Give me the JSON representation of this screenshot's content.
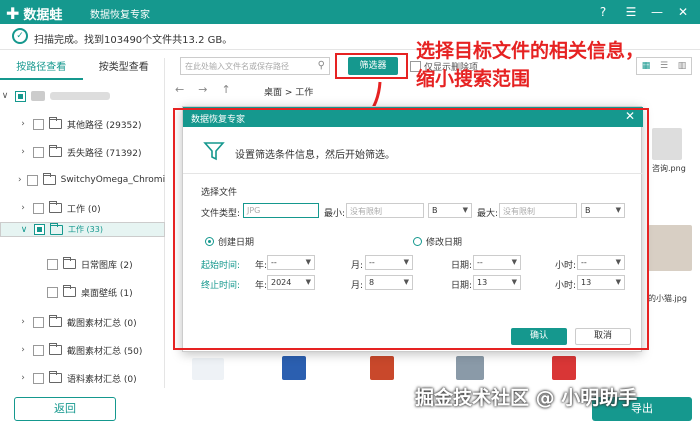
{
  "app": {
    "logo_text": "数据蛙",
    "subtitle": "数据恢复专家"
  },
  "status": {
    "text": "扫描完成。找到103490个文件共13.2 GB。"
  },
  "sidebar": {
    "tabs": [
      {
        "label": "按路径查看"
      },
      {
        "label": "按类型查看"
      }
    ],
    "tree": [
      {
        "label": "其他路径 (29352)"
      },
      {
        "label": "丢失路径 (71392)"
      },
      {
        "label": "SwitchyOmega_Chromium"
      },
      {
        "label": "工作 (0)"
      },
      {
        "label": "工作 (33)"
      },
      {
        "label": "日常图库 (2)"
      },
      {
        "label": "桌面壁纸 (1)"
      },
      {
        "label": "截图素材汇总 (0)"
      },
      {
        "label": "截图素材汇总 (50)"
      },
      {
        "label": "语料素材汇总 (0)"
      }
    ]
  },
  "toolbar": {
    "search_placeholder": "在此处输入文件名或保存路径",
    "filter_label": "筛选器",
    "only_deleted_label": "仅显示删除项",
    "breadcrumb": "桌面 > 工作"
  },
  "annotation": {
    "line1": "选择目标文件的相关信息，",
    "line2": "缩小搜索范围"
  },
  "background_files": {
    "file1": "咨询.png",
    "file2": "的小猫.jpg"
  },
  "footer": {
    "back_label": "返回",
    "export_label": "导出",
    "watermark": "掘金技术社区 @ 小明助手"
  },
  "dialog": {
    "title": "数据恢复专家",
    "hint": "设置筛选条件信息，然后开始筛选。",
    "section_title": "选择文件",
    "file_type_label": "文件类型:",
    "file_type_placeholder": "JPG",
    "min_label": "最小:",
    "max_label": "最大:",
    "size_placeholder": "没有限制",
    "unit_min": "B",
    "unit_max": "B",
    "created_label": "创建日期",
    "modified_label": "修改日期",
    "start_label": "起始时间:",
    "end_label": "终止时间:",
    "year_label": "年:",
    "month_label": "月:",
    "day_label": "日期:",
    "hour_label": "小时:",
    "start": {
      "year": "--",
      "month": "--",
      "day": "--",
      "hour": "--"
    },
    "end": {
      "year": "2024",
      "month": "8",
      "day": "13",
      "hour": "13"
    },
    "ok_label": "确认",
    "cancel_label": "取消"
  },
  "colors": {
    "accent": "#15988e",
    "annotation": "#e62222"
  }
}
